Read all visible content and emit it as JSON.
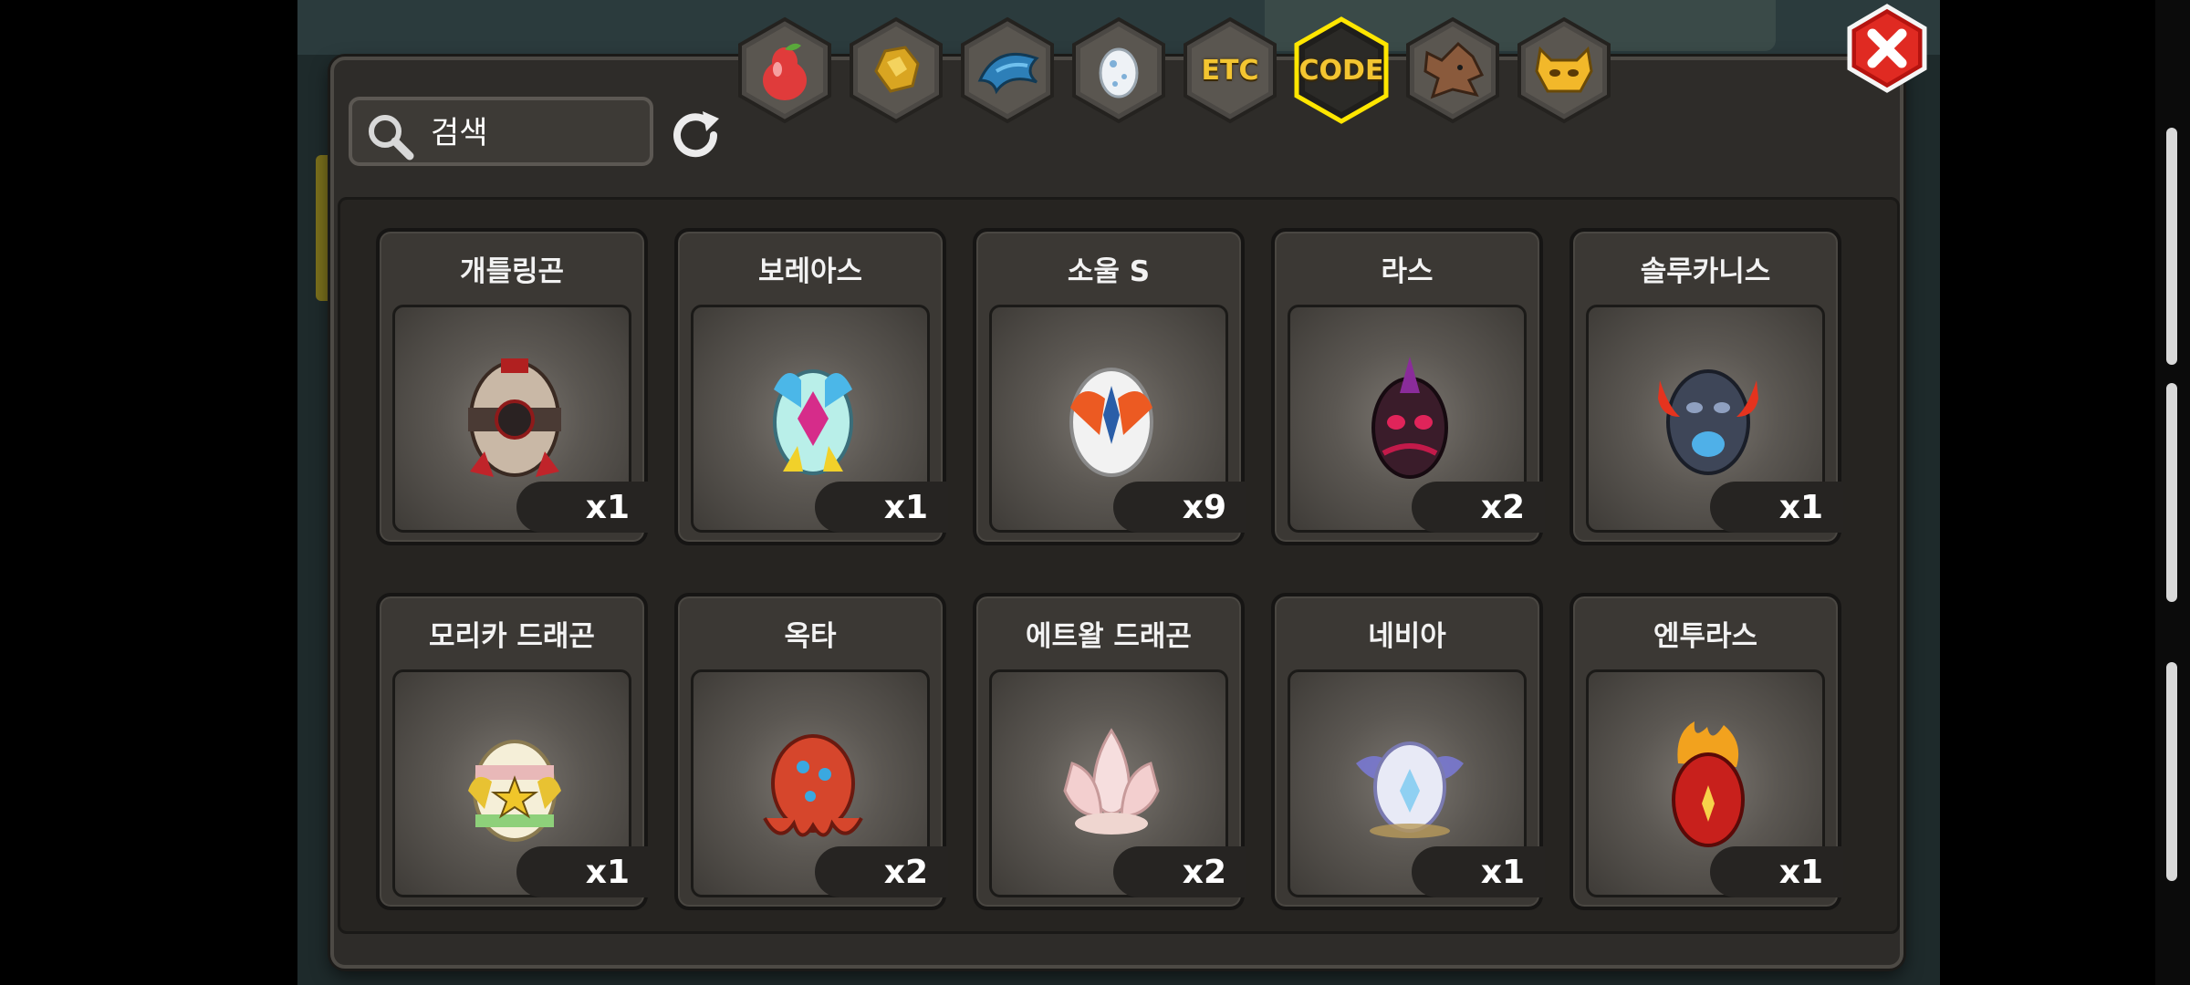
{
  "search": {
    "placeholder": "검색"
  },
  "tabs": [
    {
      "name": "fruit-tab",
      "icon": "pear-icon"
    },
    {
      "name": "gold-tab",
      "icon": "gold-nugget-icon"
    },
    {
      "name": "wing-tab",
      "icon": "blue-wing-icon"
    },
    {
      "name": "egg-tab",
      "icon": "egg-icon"
    },
    {
      "name": "etc-tab",
      "label": "ETC"
    },
    {
      "name": "code-tab",
      "label": "CODE",
      "selected": true
    },
    {
      "name": "wolf-tab",
      "icon": "wolf-icon"
    },
    {
      "name": "demon-tab",
      "icon": "demon-face-icon"
    }
  ],
  "items": [
    {
      "name": "개틀링곤",
      "qty": "x1",
      "icon": "gatling-egg-icon"
    },
    {
      "name": "보레아스",
      "qty": "x1",
      "icon": "boreas-egg-icon"
    },
    {
      "name": "소울 S",
      "qty": "x9",
      "icon": "soul-s-egg-icon"
    },
    {
      "name": "라스",
      "qty": "x2",
      "icon": "ras-egg-icon"
    },
    {
      "name": "솔루카니스",
      "qty": "x1",
      "icon": "solucanis-egg-icon"
    },
    {
      "name": "모리카 드래곤",
      "qty": "x1",
      "icon": "morika-egg-icon"
    },
    {
      "name": "옥타",
      "qty": "x2",
      "icon": "octa-egg-icon"
    },
    {
      "name": "에트왈 드래곤",
      "qty": "x2",
      "icon": "etoile-egg-icon"
    },
    {
      "name": "네비아",
      "qty": "x1",
      "icon": "nebia-egg-icon"
    },
    {
      "name": "엔투라스",
      "qty": "x1",
      "icon": "enturas-egg-icon"
    }
  ],
  "colors": {
    "tab_gold": "#f3c531",
    "selected_glow": "#ffe600",
    "close_red": "#d9231f"
  }
}
